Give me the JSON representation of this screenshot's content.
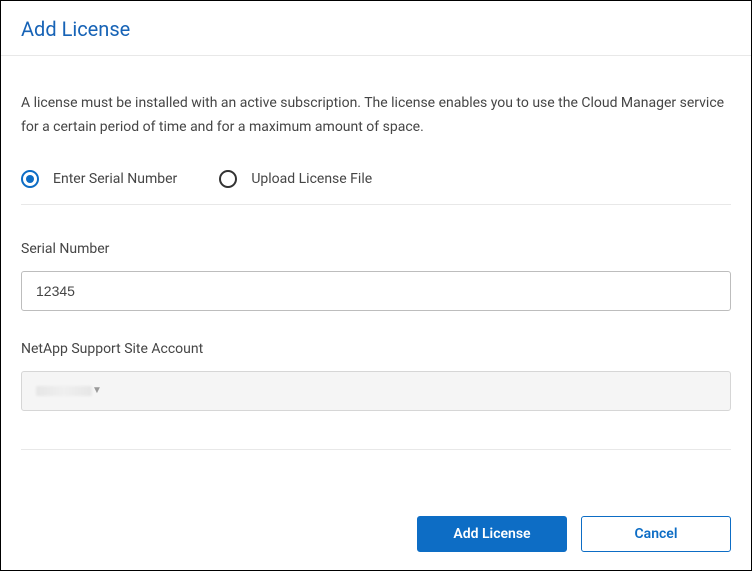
{
  "header": {
    "title": "Add License"
  },
  "description": "A license must be installed with an active subscription. The license enables you to use the Cloud Manager service for a certain period of time and for a maximum amount of space.",
  "options": {
    "enter_serial_label": "Enter Serial Number",
    "upload_file_label": "Upload License File",
    "selected": "enter_serial"
  },
  "fields": {
    "serial_label": "Serial Number",
    "serial_value": "12345",
    "nss_label": "NetApp Support Site Account",
    "nss_value": ""
  },
  "buttons": {
    "primary": "Add License",
    "secondary": "Cancel"
  }
}
